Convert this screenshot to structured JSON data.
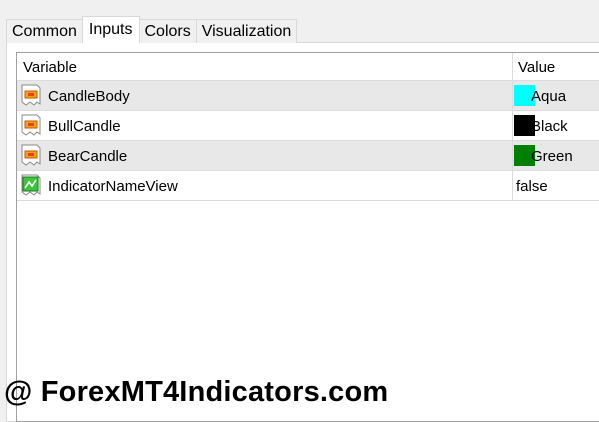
{
  "tabs": [
    {
      "label": "Common"
    },
    {
      "label": "Inputs",
      "active": true
    },
    {
      "label": "Colors"
    },
    {
      "label": "Visualization"
    }
  ],
  "table": {
    "headers": {
      "variable": "Variable",
      "value": "Value"
    },
    "rows": [
      {
        "name": "CandleBody",
        "value": "Aqua",
        "swatch": "#00ffff",
        "icon": "color-param-icon"
      },
      {
        "name": "BullCandle",
        "value": "Black",
        "swatch": "#000000",
        "icon": "color-param-icon"
      },
      {
        "name": "BearCandle",
        "value": "Green",
        "swatch": "#008000",
        "icon": "color-param-icon"
      },
      {
        "name": "IndicatorNameView",
        "value": "false",
        "icon": "bool-param-icon"
      }
    ]
  },
  "watermark": "@ ForexMT4Indicators.com",
  "colors": {
    "row_shade": "#e8e8e8",
    "border": "#dcdcdc"
  }
}
